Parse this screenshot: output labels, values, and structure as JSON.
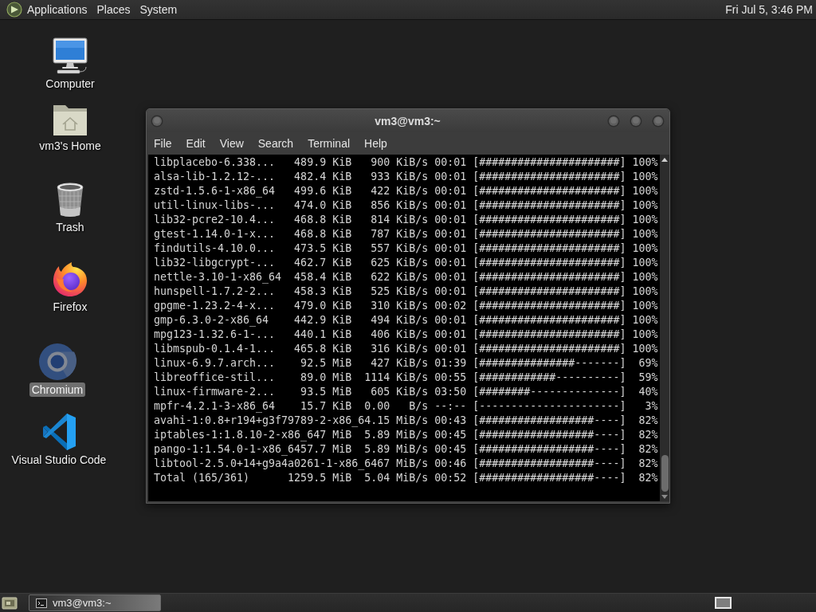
{
  "top_panel": {
    "menus": [
      "Applications",
      "Places",
      "System"
    ],
    "clock": "Fri Jul 5, 3:46 PM"
  },
  "desktop_icons": [
    {
      "kind": "computer",
      "label": "Computer",
      "selected": false
    },
    {
      "kind": "home",
      "label": "vm3's Home",
      "selected": false
    },
    {
      "kind": "trash",
      "label": "Trash",
      "selected": false
    },
    {
      "kind": "firefox",
      "label": "Firefox",
      "selected": false
    },
    {
      "kind": "chromium",
      "label": "Chromium",
      "selected": true
    },
    {
      "kind": "vscode",
      "label": "Visual Studio Code",
      "selected": false
    }
  ],
  "terminal_window": {
    "title": "vm3@vm3:~",
    "menu": [
      "File",
      "Edit",
      "View",
      "Search",
      "Terminal",
      "Help"
    ],
    "lines": [
      "libplacebo-6.338...   489.9 KiB   900 KiB/s 00:01 [######################] 100%",
      "alsa-lib-1.2.12-...   482.4 KiB   933 KiB/s 00:01 [######################] 100%",
      "zstd-1.5.6-1-x86_64   499.6 KiB   422 KiB/s 00:01 [######################] 100%",
      "util-linux-libs-...   474.0 KiB   856 KiB/s 00:01 [######################] 100%",
      "lib32-pcre2-10.4...   468.8 KiB   814 KiB/s 00:01 [######################] 100%",
      "gtest-1.14.0-1-x...   468.8 KiB   787 KiB/s 00:01 [######################] 100%",
      "findutils-4.10.0...   473.5 KiB   557 KiB/s 00:01 [######################] 100%",
      "lib32-libgcrypt-...   462.7 KiB   625 KiB/s 00:01 [######################] 100%",
      "nettle-3.10-1-x86_64  458.4 KiB   622 KiB/s 00:01 [######################] 100%",
      "hunspell-1.7.2-2...   458.3 KiB   525 KiB/s 00:01 [######################] 100%",
      "gpgme-1.23.2-4-x...   479.0 KiB   310 KiB/s 00:02 [######################] 100%",
      "gmp-6.3.0-2-x86_64    442.9 KiB   494 KiB/s 00:01 [######################] 100%",
      "mpg123-1.32.6-1-...   440.1 KiB   406 KiB/s 00:01 [######################] 100%",
      "libmspub-0.1.4-1...   465.8 KiB   316 KiB/s 00:01 [######################] 100%",
      "linux-6.9.7.arch...    92.5 MiB   427 KiB/s 01:39 [###############-------]  69%",
      "libreoffice-stil...    89.0 MiB  1114 KiB/s 00:55 [############----------]  59%",
      "linux-firmware-2...    93.5 MiB   605 KiB/s 03:50 [########--------------]  40%",
      "mpfr-4.2.1-3-x86_64    15.7 KiB  0.00   B/s --:-- [----------------------]   3%",
      "avahi-1:0.8+r194+g3f79789-2-x86_64.15 MiB/s 00:43 [##################----]  82%",
      "iptables-1:1.8.10-2-x86_647 MiB  5.89 MiB/s 00:45 [##################----]  82%",
      "pango-1:1.54.0-1-x86_6457.7 MiB  5.89 MiB/s 00:45 [##################----]  82%",
      "libtool-2.5.0+14+g9a4a0261-1-x86_6467 MiB/s 00:46 [##################----]  82%",
      "Total (165/361)      1259.5 MiB  5.04 MiB/s 00:52 [##################----]  82%"
    ]
  },
  "bottom_panel": {
    "tasks": [
      {
        "label": "vm3@vm3:~",
        "selected": true
      }
    ],
    "workspaces": [
      {
        "selected": true
      }
    ]
  }
}
